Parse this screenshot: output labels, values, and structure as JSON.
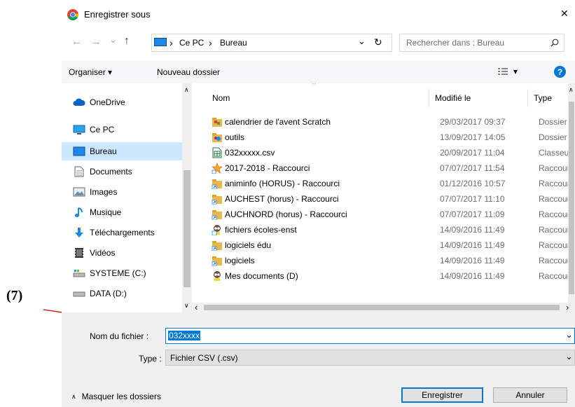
{
  "annotation": {
    "label": "(7)"
  },
  "window": {
    "title": "Enregistrer sous",
    "close_glyph": "✕"
  },
  "nav": {
    "back": "←",
    "forward": "→",
    "recent": "⌄",
    "up": "↑",
    "path": [
      "Ce PC",
      "Bureau"
    ],
    "path_sep": "›",
    "dropdown": "⌄",
    "refresh": "↻",
    "search_placeholder": "Rechercher dans : Bureau"
  },
  "toolbar": {
    "organize": "Organiser ▾",
    "new_folder": "Nouveau dossier",
    "view_arrow": "▾",
    "help": "?"
  },
  "sidebar": {
    "items": [
      {
        "label": "OneDrive",
        "icon": "cloud-icon"
      },
      {
        "label": "Ce PC",
        "icon": "computer-icon"
      },
      {
        "label": "Bureau",
        "icon": "desktop-icon",
        "selected": true
      },
      {
        "label": "Documents",
        "icon": "document-icon"
      },
      {
        "label": "Images",
        "icon": "picture-icon"
      },
      {
        "label": "Musique",
        "icon": "music-icon"
      },
      {
        "label": "Téléchargements",
        "icon": "download-icon"
      },
      {
        "label": "Vidéos",
        "icon": "video-icon"
      },
      {
        "label": "SYSTEME (C:)",
        "icon": "system-drive-icon"
      },
      {
        "label": "DATA (D:)",
        "icon": "drive-icon"
      }
    ]
  },
  "filelist": {
    "columns": {
      "name": "Nom",
      "modified": "Modifié le",
      "type": "Type"
    },
    "rows": [
      {
        "name": "calendrier de l'avent Scratch",
        "modified": "29/03/2017 09:37",
        "type": "Dossier",
        "icon": "folder-icon"
      },
      {
        "name": "outils",
        "modified": "13/09/2017 14:05",
        "type": "Dossier",
        "icon": "folder-tools-icon"
      },
      {
        "name": "032xxxxx.csv",
        "modified": "20/09/2017 11:04",
        "type": "Classeur",
        "icon": "csv-file-icon"
      },
      {
        "name": "2017-2018 - Raccourci",
        "modified": "07/07/2017 11:54",
        "type": "Raccourci",
        "icon": "star-shortcut-icon"
      },
      {
        "name": "animinfo (HORUS) - Raccourci",
        "modified": "01/12/2016 10:57",
        "type": "Raccourci",
        "icon": "shortcut-icon"
      },
      {
        "name": "AUCHEST (horus) - Raccourci",
        "modified": "07/07/2017 11:10",
        "type": "Raccourci",
        "icon": "shortcut-icon"
      },
      {
        "name": "AUCHNORD (horus) - Raccourci",
        "modified": "07/07/2017 11:09",
        "type": "Raccourci",
        "icon": "shortcut-icon"
      },
      {
        "name": "fichiers écoles-enst",
        "modified": "14/09/2016 11:49",
        "type": "Raccourci",
        "icon": "character-shortcut-icon"
      },
      {
        "name": "logiciels édu",
        "modified": "14/09/2016 11:49",
        "type": "Raccourci",
        "icon": "shortcut-icon"
      },
      {
        "name": "logiciels",
        "modified": "14/09/2016 11:49",
        "type": "Raccourci",
        "icon": "shortcut-icon"
      },
      {
        "name": "Mes documents (D)",
        "modified": "14/09/2016 11:49",
        "type": "Raccourci",
        "icon": "character-shortcut-icon"
      }
    ]
  },
  "form": {
    "filename_label": "Nom du fichier :",
    "filename_value": "032xxxx",
    "type_label": "Type :",
    "type_value": "Fichier CSV (.csv)"
  },
  "footer": {
    "hide_folders": "Masquer les dossiers",
    "save": "Enregistrer",
    "cancel": "Annuler"
  },
  "colors": {
    "accent": "#0078d7",
    "selection": "#cce8ff",
    "annotation": "#c00000"
  }
}
